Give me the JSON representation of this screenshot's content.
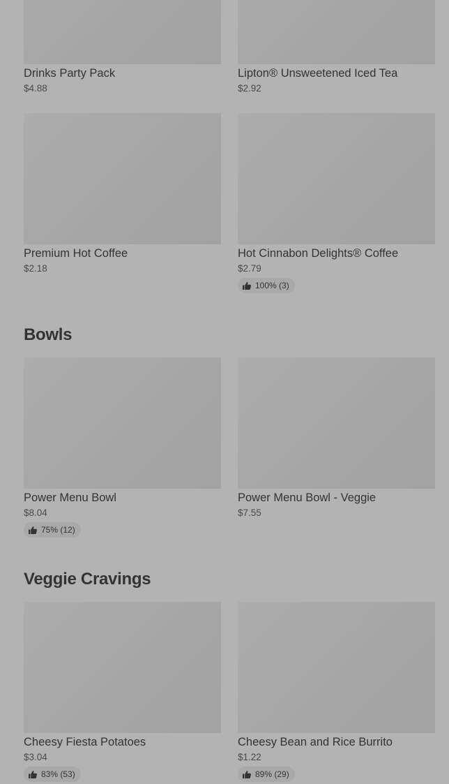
{
  "partial_section": {
    "items": [
      {
        "name": "Drinks Party Pack",
        "price": "$4.88"
      },
      {
        "name": "Lipton® Unsweetened Iced Tea",
        "price": "$2.92"
      },
      {
        "name": "Premium Hot Coffee",
        "price": "$2.18"
      },
      {
        "name": "Hot Cinnabon Delights® Coffee",
        "price": "$2.79",
        "rating": "100% (3)"
      }
    ]
  },
  "bowls": {
    "title": "Bowls",
    "items": [
      {
        "name": "Power Menu Bowl",
        "price": "$8.04",
        "rating": "75% (12)"
      },
      {
        "name": "Power Menu Bowl - Veggie",
        "price": "$7.55"
      }
    ]
  },
  "veggie": {
    "title": "Veggie Cravings",
    "items": [
      {
        "name": "Cheesy Fiesta Potatoes",
        "price": "$3.04",
        "rating": "83% (53)"
      },
      {
        "name": "Cheesy Bean and Rice Burrito",
        "price": "$1.22",
        "rating": "89% (29)"
      }
    ]
  },
  "icons": {
    "rating": "thumbs-up-icon"
  },
  "colors": {
    "background": "#b3b3b3",
    "image_placeholder": "#a8a8a8",
    "text": "#333333",
    "rating_pill": "#a9a9a9"
  }
}
